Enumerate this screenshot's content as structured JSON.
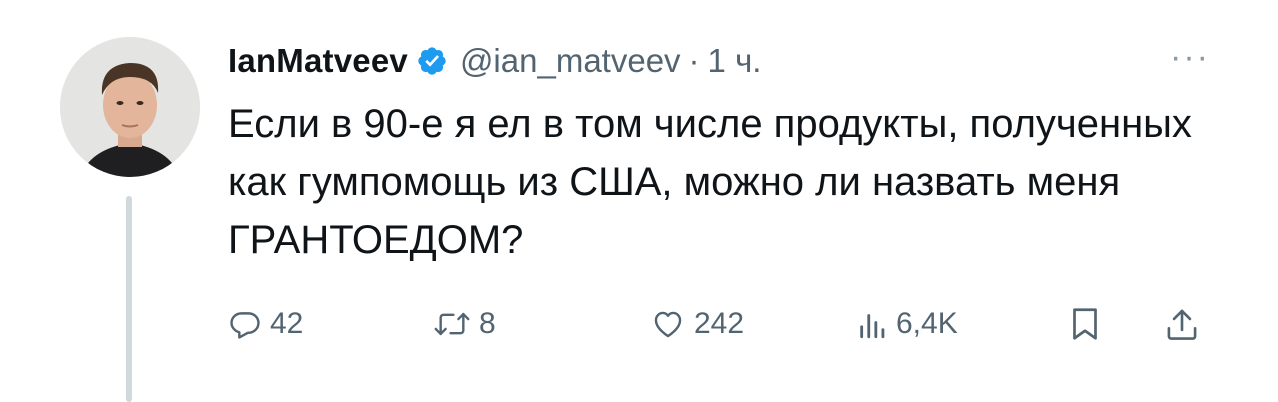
{
  "author": {
    "display_name": "IanMatveev",
    "handle": "@ian_matveev",
    "separator": "·",
    "time": "1 ч.",
    "verified": true
  },
  "tweet": {
    "text": "Если в 90-е я ел в том числе продукты, полученных как гумпомощь из США, можно ли назвать меня ГРАНТОЕДОМ?"
  },
  "more_label": "···",
  "actions": {
    "reply": {
      "icon": "reply-icon",
      "count": "42"
    },
    "retweet": {
      "icon": "retweet-icon",
      "count": "8"
    },
    "like": {
      "icon": "heart-icon",
      "count": "242"
    },
    "views": {
      "icon": "views-icon",
      "count": "6,4K"
    },
    "bookmark": {
      "icon": "bookmark-icon"
    },
    "share": {
      "icon": "share-icon"
    }
  },
  "colors": {
    "text": "#0f1419",
    "secondary": "#536471",
    "verified": "#1d9bf0",
    "thread_line": "#cfd9de"
  }
}
